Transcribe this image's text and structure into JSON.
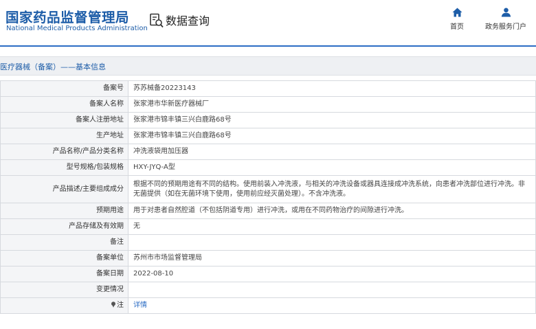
{
  "header": {
    "logo_cn": "国家药品监督管理局",
    "logo_en": "National Medical Products Administration",
    "query_title": "数据查询",
    "nav": {
      "home_label": "首页",
      "gov_label": "政务服务门户"
    }
  },
  "section": {
    "title": "医疗器械（备案）——基本信息"
  },
  "rows": [
    {
      "label": "备案号",
      "value": "苏苏械备20223143"
    },
    {
      "label": "备案人名称",
      "value": "张家港市华新医疗器械厂"
    },
    {
      "label": "备案人注册地址",
      "value": "张家港市锦丰镇三兴白鹿路68号"
    },
    {
      "label": "生产地址",
      "value": "张家港市锦丰镇三兴白鹿路68号"
    },
    {
      "label": "产品名称/产品分类名称",
      "value": "冲洗液袋用加压器"
    },
    {
      "label": "型号规格/包装规格",
      "value": "HXY-JYQ-A型"
    },
    {
      "label": "产品描述/主要组成成分",
      "value": "根据不同的预期用途有不同的结构。使用前装入冲洗液，与相关的冲洗设备或器具连接成冲洗系统，向患者冲洗部位进行冲洗。非无菌提供（如在无菌环境下使用，使用前应经灭菌处理）。不含冲洗液。"
    },
    {
      "label": "预期用途",
      "value": "用于对患者自然腔道（不包括阴道专用）进行冲洗，或用在不同药物治疗的间隙进行冲洗。"
    },
    {
      "label": "产品存储及有效期",
      "value": "无"
    },
    {
      "label": "备注",
      "value": ""
    },
    {
      "label": "备案单位",
      "value": "苏州市市场监督管理局"
    },
    {
      "label": "备案日期",
      "value": "2022-08-10"
    },
    {
      "label": "变更情况",
      "value": ""
    },
    {
      "label": "注",
      "value": "详情"
    }
  ]
}
